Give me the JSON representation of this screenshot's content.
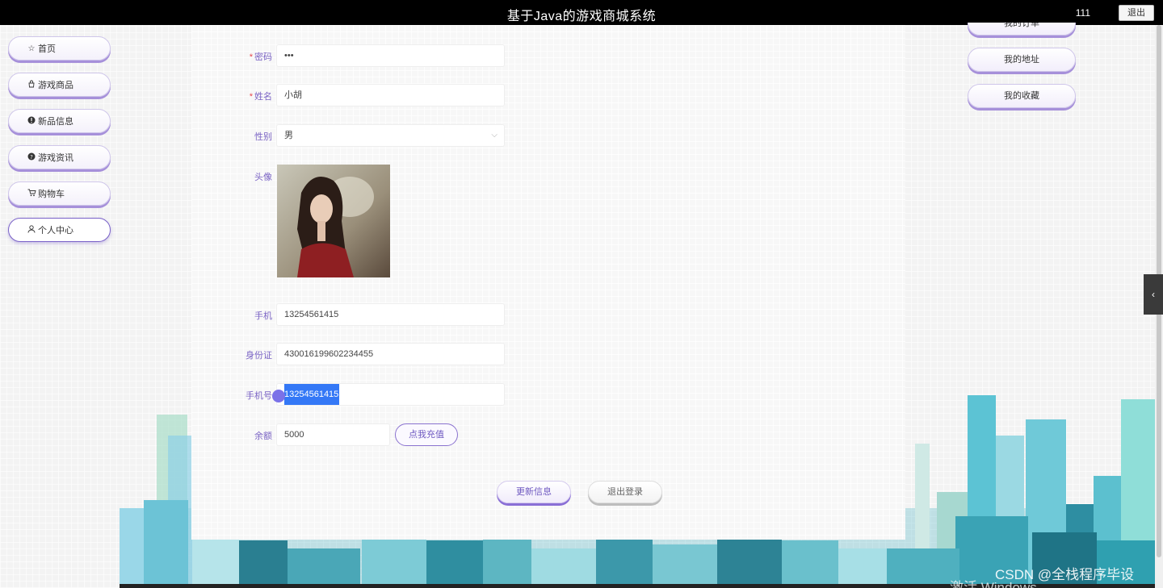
{
  "header": {
    "title": "基于Java的游戏商城系统",
    "username": "111",
    "logout_label": "退出"
  },
  "left_nav": [
    {
      "label": "首页",
      "icon": "star-icon"
    },
    {
      "label": "游戏商品",
      "icon": "bag-icon"
    },
    {
      "label": "新品信息",
      "icon": "info-icon"
    },
    {
      "label": "游戏资讯",
      "icon": "question-icon"
    },
    {
      "label": "购物车",
      "icon": "cart-icon"
    },
    {
      "label": "个人中心",
      "icon": "user-icon",
      "active": true
    }
  ],
  "form": {
    "password": {
      "label": "密码",
      "required": true,
      "value": "•••"
    },
    "name": {
      "label": "姓名",
      "required": true,
      "value": "小胡"
    },
    "gender": {
      "label": "性别",
      "value": "男"
    },
    "avatar": {
      "label": "头像"
    },
    "phone": {
      "label": "手机",
      "value": "13254561415"
    },
    "id_card": {
      "label": "身份证",
      "value": "430016199602234455"
    },
    "mobile": {
      "label": "手机号",
      "value": "13254561415"
    },
    "balance": {
      "label": "余额",
      "value": "5000",
      "recharge_label": "点我充值"
    },
    "update_label": "更新信息",
    "logout_label": "退出登录"
  },
  "right_nav": [
    {
      "label": "我的订单"
    },
    {
      "label": "我的地址"
    },
    {
      "label": "我的收藏"
    }
  ],
  "watermark": "CSDN @全栈程序毕设",
  "windows_activation": "激活 Windows",
  "colors": {
    "accent": "#7a63c4",
    "required": "#e5484d",
    "selection": "#3478f6"
  }
}
